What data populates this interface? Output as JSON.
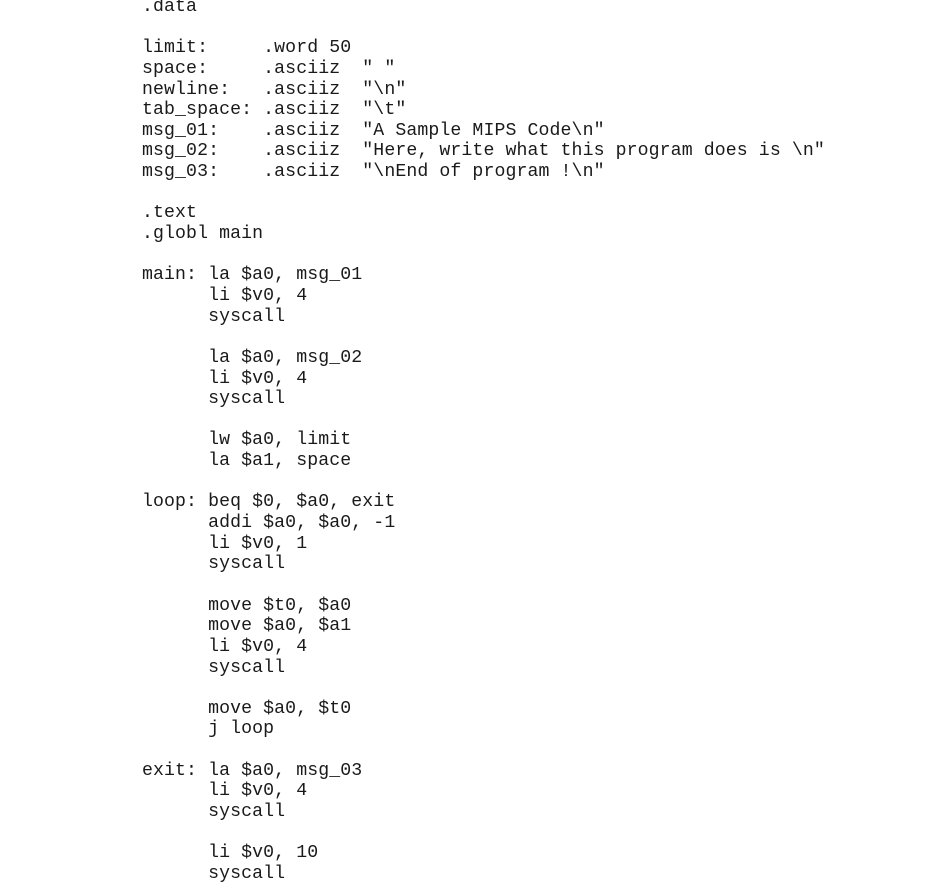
{
  "document": {
    "language": "MIPS assembly",
    "lines": [
      ".data",
      "",
      "limit:     .word 50",
      "space:     .asciiz  \" \"",
      "newline:   .asciiz  \"\\n\"",
      "tab_space: .asciiz  \"\\t\"",
      "msg_01:    .asciiz  \"A Sample MIPS Code\\n\"",
      "msg_02:    .asciiz  \"Here, write what this program does is \\n\"",
      "msg_03:    .asciiz  \"\\nEnd of program !\\n\"",
      "",
      ".text",
      ".globl main",
      "",
      "main: la $a0, msg_01",
      "      li $v0, 4",
      "      syscall",
      "",
      "      la $a0, msg_02",
      "      li $v0, 4",
      "      syscall",
      "",
      "      lw $a0, limit",
      "      la $a1, space",
      "",
      "loop: beq $0, $a0, exit",
      "      addi $a0, $a0, -1",
      "      li $v0, 1",
      "      syscall",
      "",
      "      move $t0, $a0",
      "      move $a0, $a1",
      "      li $v0, 4",
      "      syscall",
      "",
      "      move $a0, $t0",
      "      j loop",
      "",
      "exit: la $a0, msg_03",
      "      li $v0, 4",
      "      syscall",
      "",
      "      li $v0, 10",
      "      syscall"
    ]
  }
}
